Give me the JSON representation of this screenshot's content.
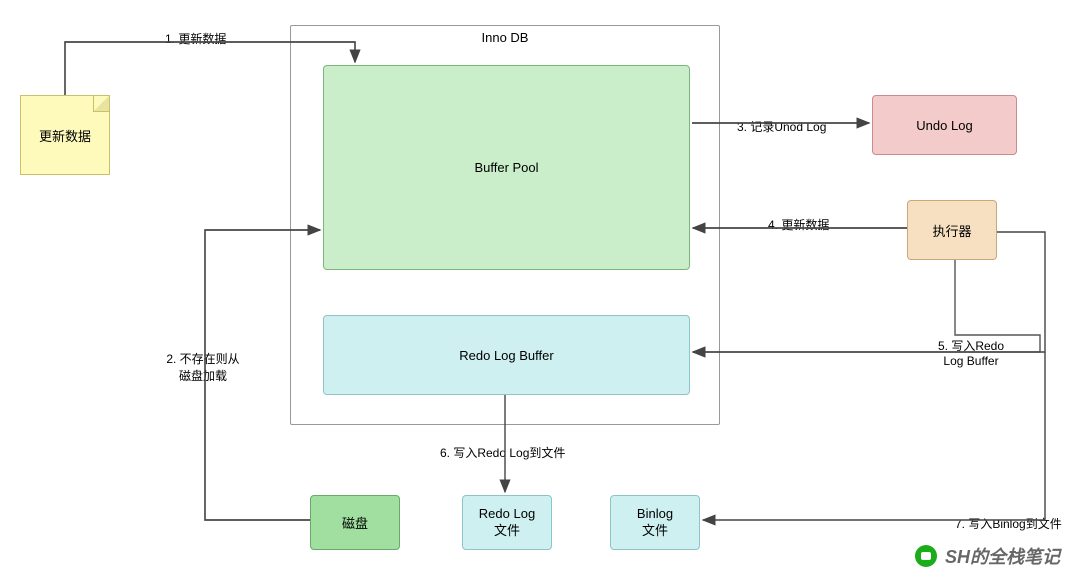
{
  "nodes": {
    "update_data_note": "更新数据",
    "innodb": "Inno DB",
    "buffer_pool": "Buffer Pool",
    "redo_log_buffer": "Redo Log Buffer",
    "undo_log": "Undo Log",
    "executor": "执行器",
    "disk": "磁盘",
    "redo_log_file": "Redo Log\n文件",
    "binlog": "Binlog\n文件"
  },
  "edges": {
    "e1": "1. 更新数据",
    "e2": "2. 不存在则从\n磁盘加载",
    "e3": "3. 记录Unod Log",
    "e4": "4. 更新数据",
    "e5": "5. 写入Redo\nLog Buffer",
    "e6": "6. 写入Redo Log到文件",
    "e7": "7. 写入Binlog到文件"
  },
  "watermark": "SH的全栈笔记"
}
